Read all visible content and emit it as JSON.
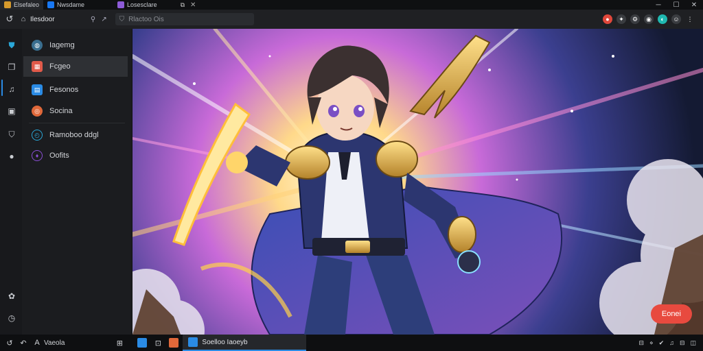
{
  "tabs": [
    {
      "label": "Elsefaleo",
      "icon": "app-logo-icon",
      "color": "#d69a2c"
    },
    {
      "label": "Nwsdame",
      "icon": "facebook-icon",
      "color": "#1877f2"
    },
    {
      "label": "Losesclare",
      "icon": "purple-app-icon",
      "color": "#8d5bd8"
    }
  ],
  "nav": {
    "app_label": "Ilesdoor",
    "url_placeholder": "Rlactoo Ois"
  },
  "menu": [
    {
      "label": "Iagemg",
      "icon": "globe-icon",
      "color": "#3a6e8f"
    },
    {
      "label": "Fcgeo",
      "icon": "image-icon",
      "color": "#e05a4a",
      "selected": true
    },
    {
      "label": "Fesonos",
      "icon": "gallery-icon",
      "color": "#2a8be5"
    },
    {
      "label": "Socina",
      "icon": "orange-circle-icon",
      "color": "#e0683a"
    },
    {
      "label": "Ramoboo ddgl",
      "icon": "clock-icon",
      "color": "#2aa7d8"
    },
    {
      "label": "Oofits",
      "icon": "purple-pin-icon",
      "color": "#8b4fd6"
    }
  ],
  "main": {
    "action_label": "Eonei",
    "accent": "#e84a3f"
  },
  "taskbar": {
    "label": "Vaeola",
    "window_title": "Soelloo Iaoeyb"
  }
}
